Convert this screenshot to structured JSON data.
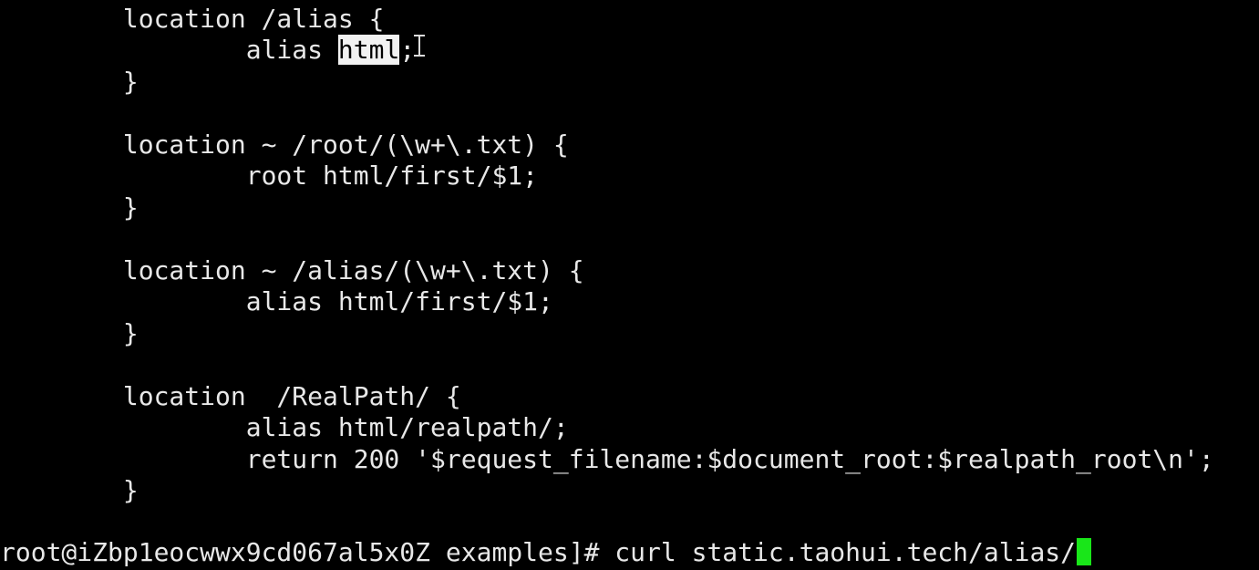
{
  "terminal": {
    "code_lines": [
      "        location /alias {",
      "                alias ",
      "        }",
      "",
      "        location ~ /root/(\\w+\\.txt) {",
      "                root html/first/$1;",
      "        }",
      "",
      "        location ~ /alias/(\\w+\\.txt) {",
      "                alias html/first/$1;",
      "        }",
      "",
      "        location  /RealPath/ {",
      "                alias html/realpath/;",
      "                return 200 '$request_filename:$document_root:$realpath_root\\n';",
      "        }"
    ],
    "selected_word": "html",
    "selected_suffix": ";",
    "prompt": "root@iZbp1eocwwx9cd067al5x0Z examples]# ",
    "command": "curl static.taohui.tech/alias/",
    "colors": {
      "background": "#000000",
      "text": "#e8e8e8",
      "cursor": "#19e619",
      "selection": "#f2f2f2"
    },
    "icons": {
      "mouse_pointer": "text-ibeam-cursor-icon"
    }
  }
}
